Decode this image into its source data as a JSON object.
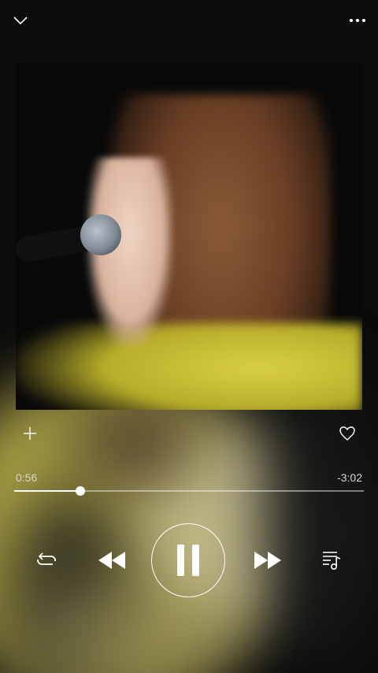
{
  "player": {
    "time_elapsed": "0:56",
    "time_remaining": "-3:02",
    "progress_fraction": 0.19,
    "is_playing": true,
    "artwork_description_icon": "album-artwork"
  },
  "icons": {
    "collapse": "chevron-down-icon",
    "more": "more-options-icon",
    "add": "plus-icon",
    "like": "heart-icon",
    "repeat": "repeat-icon",
    "rewind": "rewind-icon",
    "pause": "pause-icon",
    "forward": "fast-forward-icon",
    "queue": "queue-icon"
  },
  "colors": {
    "foreground": "#ffffff",
    "background": "#0b0b0b",
    "track": "#737373"
  }
}
